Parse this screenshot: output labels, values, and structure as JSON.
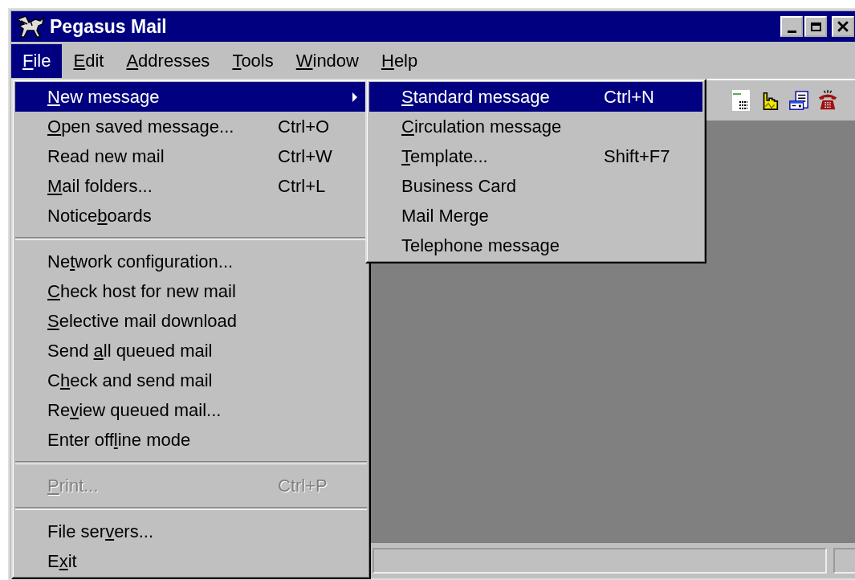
{
  "window": {
    "title": "Pegasus Mail"
  },
  "menubar": [
    {
      "label": [
        {
          "text": "F",
          "underline": true
        },
        {
          "text": "ile",
          "underline": false
        }
      ],
      "selected": true
    },
    {
      "label": [
        {
          "text": "E",
          "underline": true
        },
        {
          "text": "dit",
          "underline": false
        }
      ],
      "selected": false
    },
    {
      "label": [
        {
          "text": "A",
          "underline": true
        },
        {
          "text": "ddresses",
          "underline": false
        }
      ],
      "selected": false
    },
    {
      "label": [
        {
          "text": "T",
          "underline": true
        },
        {
          "text": "ools",
          "underline": false
        }
      ],
      "selected": false
    },
    {
      "label": [
        {
          "text": "W",
          "underline": true
        },
        {
          "text": "indow",
          "underline": false
        }
      ],
      "selected": false
    },
    {
      "label": [
        {
          "text": "H",
          "underline": true
        },
        {
          "text": "elp",
          "underline": false
        }
      ],
      "selected": false
    }
  ],
  "file_menu": {
    "items": [
      {
        "kind": "item",
        "label": [
          {
            "text": "N",
            "underline": true
          },
          {
            "text": "ew message",
            "underline": false
          }
        ],
        "selected": true,
        "disabled": false,
        "submenu": true
      },
      {
        "kind": "item",
        "label": [
          {
            "text": "O",
            "underline": true
          },
          {
            "text": "pen saved message...",
            "underline": false
          }
        ],
        "shortcut": "Ctrl+O",
        "selected": false,
        "disabled": false,
        "submenu": false
      },
      {
        "kind": "item",
        "label": [
          {
            "text": "Read new mail",
            "underline": false
          }
        ],
        "shortcut": "Ctrl+W",
        "selected": false,
        "disabled": false,
        "submenu": false
      },
      {
        "kind": "item",
        "label": [
          {
            "text": "M",
            "underline": true
          },
          {
            "text": "ail folders...",
            "underline": false
          }
        ],
        "shortcut": "Ctrl+L",
        "selected": false,
        "disabled": false,
        "submenu": false
      },
      {
        "kind": "item",
        "label": [
          {
            "text": "Notice",
            "underline": false
          },
          {
            "text": "b",
            "underline": true
          },
          {
            "text": "oards",
            "underline": false
          }
        ],
        "selected": false,
        "disabled": false,
        "submenu": false
      },
      {
        "kind": "separator"
      },
      {
        "kind": "item",
        "label": [
          {
            "text": "Ne",
            "underline": false
          },
          {
            "text": "t",
            "underline": true
          },
          {
            "text": "work configuration...",
            "underline": false
          }
        ],
        "selected": false,
        "disabled": false,
        "submenu": false
      },
      {
        "kind": "item",
        "label": [
          {
            "text": "C",
            "underline": true
          },
          {
            "text": "heck host for new mail",
            "underline": false
          }
        ],
        "selected": false,
        "disabled": false,
        "submenu": false
      },
      {
        "kind": "item",
        "label": [
          {
            "text": "S",
            "underline": true
          },
          {
            "text": "elective mail download",
            "underline": false
          }
        ],
        "selected": false,
        "disabled": false,
        "submenu": false
      },
      {
        "kind": "item",
        "label": [
          {
            "text": "Send ",
            "underline": false
          },
          {
            "text": "a",
            "underline": true
          },
          {
            "text": "ll queued mail",
            "underline": false
          }
        ],
        "selected": false,
        "disabled": false,
        "submenu": false
      },
      {
        "kind": "item",
        "label": [
          {
            "text": "C",
            "underline": false
          },
          {
            "text": "h",
            "underline": true
          },
          {
            "text": "eck and send mail",
            "underline": false
          }
        ],
        "selected": false,
        "disabled": false,
        "submenu": false
      },
      {
        "kind": "item",
        "label": [
          {
            "text": "Re",
            "underline": false
          },
          {
            "text": "v",
            "underline": true
          },
          {
            "text": "iew queued mail...",
            "underline": false
          }
        ],
        "selected": false,
        "disabled": false,
        "submenu": false
      },
      {
        "kind": "item",
        "label": [
          {
            "text": "Enter off",
            "underline": false
          },
          {
            "text": "l",
            "underline": true
          },
          {
            "text": "ine mode",
            "underline": false
          }
        ],
        "selected": false,
        "disabled": false,
        "submenu": false
      },
      {
        "kind": "separator"
      },
      {
        "kind": "item",
        "label": [
          {
            "text": "P",
            "underline": true
          },
          {
            "text": "rint...",
            "underline": false
          }
        ],
        "shortcut": "Ctrl+P",
        "selected": false,
        "disabled": true,
        "submenu": false
      },
      {
        "kind": "separator"
      },
      {
        "kind": "item",
        "label": [
          {
            "text": "File ser",
            "underline": false
          },
          {
            "text": "v",
            "underline": true
          },
          {
            "text": "ers...",
            "underline": false
          }
        ],
        "selected": false,
        "disabled": false,
        "submenu": false
      },
      {
        "kind": "item",
        "label": [
          {
            "text": "E",
            "underline": false
          },
          {
            "text": "x",
            "underline": true
          },
          {
            "text": "it",
            "underline": false
          }
        ],
        "selected": false,
        "disabled": false,
        "submenu": false
      }
    ]
  },
  "new_message_submenu": {
    "items": [
      {
        "label": [
          {
            "text": "S",
            "underline": true
          },
          {
            "text": "tandard message",
            "underline": false
          }
        ],
        "shortcut": "Ctrl+N",
        "selected": true
      },
      {
        "label": [
          {
            "text": "C",
            "underline": true
          },
          {
            "text": "irculation message",
            "underline": false
          }
        ],
        "selected": false
      },
      {
        "label": [
          {
            "text": "T",
            "underline": true
          },
          {
            "text": "emplate...",
            "underline": false
          }
        ],
        "shortcut": "Shift+F7",
        "selected": false
      },
      {
        "label": [
          {
            "text": "Business Card",
            "underline": false
          }
        ],
        "selected": false
      },
      {
        "label": [
          {
            "text": "Mail Merge",
            "underline": false
          }
        ],
        "selected": false
      },
      {
        "label": [
          {
            "text": "Telephone message",
            "underline": false
          }
        ],
        "selected": false
      }
    ]
  }
}
